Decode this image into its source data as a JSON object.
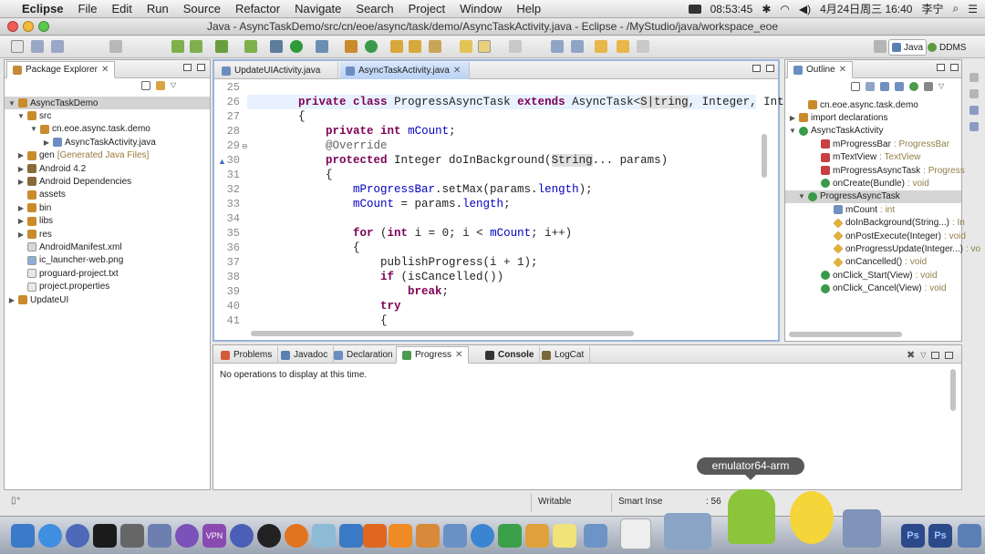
{
  "menubar": {
    "app_name": "Eclipse",
    "menus": [
      "File",
      "Edit",
      "Run",
      "Source",
      "Refactor",
      "Navigate",
      "Search",
      "Project",
      "Window",
      "Help"
    ],
    "clock": "08:53:45",
    "date_time": "4月24日周三  16:40",
    "user": "李宁"
  },
  "window": {
    "title": "Java - AsyncTaskDemo/src/cn/eoe/async/task/demo/AsyncTaskActivity.java - Eclipse - /MyStudio/java/workspace_eoe"
  },
  "perspectives": [
    "Java",
    "DDMS"
  ],
  "package_explorer": {
    "title": "Package Explorer",
    "tree": [
      {
        "label": "AsyncTaskDemo",
        "twisty": "▼"
      },
      {
        "label": "src",
        "twisty": "▼"
      },
      {
        "label": "cn.eoe.async.task.demo",
        "twisty": "▼"
      },
      {
        "label": "AsyncTaskActivity.java",
        "twisty": "▶"
      },
      {
        "label": "gen",
        "suffix": "[Generated Java Files]",
        "twisty": "▶"
      },
      {
        "label": "Android 4.2",
        "twisty": "▶"
      },
      {
        "label": "Android Dependencies",
        "twisty": "▶"
      },
      {
        "label": "assets",
        "twisty": ""
      },
      {
        "label": "bin",
        "twisty": "▶"
      },
      {
        "label": "libs",
        "twisty": "▶"
      },
      {
        "label": "res",
        "twisty": "▶"
      },
      {
        "label": "AndroidManifest.xml",
        "twisty": ""
      },
      {
        "label": "ic_launcher-web.png",
        "twisty": ""
      },
      {
        "label": "proguard-project.txt",
        "twisty": ""
      },
      {
        "label": "project.properties",
        "twisty": ""
      },
      {
        "label": "UpdateUI",
        "twisty": "▶"
      }
    ]
  },
  "editor": {
    "tabs": [
      "UpdateUIActivity.java",
      "AsyncTaskActivity.java"
    ],
    "line_numbers": [
      "25",
      "26",
      "27",
      "28",
      "29",
      "30",
      "31",
      "32",
      "33",
      "34",
      "35",
      "36",
      "37",
      "38",
      "39",
      "40",
      "41"
    ]
  },
  "outline": {
    "title": "Outline",
    "items": [
      {
        "label": "cn.eoe.async.task.demo",
        "type": ""
      },
      {
        "label": "import declarations",
        "type": ""
      },
      {
        "label": "AsyncTaskActivity",
        "type": ""
      },
      {
        "label": "mProgressBar",
        "type": " : ProgressBar"
      },
      {
        "label": "mTextView",
        "type": " : TextView"
      },
      {
        "label": "mProgressAsyncTask",
        "type": " : Progress"
      },
      {
        "label": "onCreate(Bundle)",
        "type": " : void"
      },
      {
        "label": "ProgressAsyncTask",
        "type": ""
      },
      {
        "label": "mCount",
        "type": " : int"
      },
      {
        "label": "doInBackground(String...)",
        "type": " : In"
      },
      {
        "label": "onPostExecute(Integer)",
        "type": " : void"
      },
      {
        "label": "onProgressUpdate(Integer...)",
        "type": " : vo"
      },
      {
        "label": "onCancelled()",
        "type": " : void"
      },
      {
        "label": "onClick_Start(View)",
        "type": " : void"
      },
      {
        "label": "onClick_Cancel(View)",
        "type": " : void"
      }
    ]
  },
  "bottom": {
    "tabs": [
      "Problems",
      "Javadoc",
      "Declaration",
      "Progress",
      "Console",
      "LogCat"
    ],
    "message": "No operations to display at this time."
  },
  "status": {
    "writable": "Writable",
    "insert": "Smart Inse",
    "position": ": 56"
  },
  "dock": {
    "tooltip": "emulator64-arm"
  }
}
